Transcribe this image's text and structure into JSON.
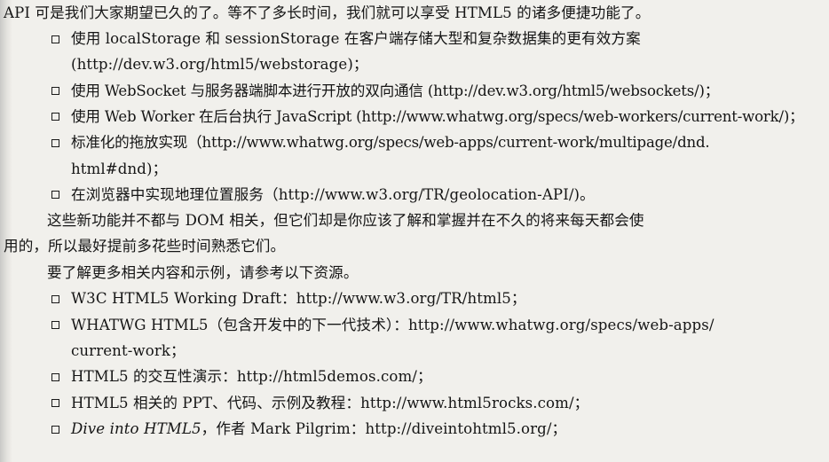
{
  "page": {
    "intro_line": "API 可是我们大家期望已久的了。等不了多长时间，我们就可以享受 HTML5 的诸多便捷功能了。",
    "feature_list": [
      {
        "line1": "使用 localStorage 和 sessionStorage 在客户端存储大型和复杂数据集的更有效方案",
        "line2": "(http://dev.w3.org/html5/webstorage)；"
      },
      {
        "line1": "使用 WebSocket 与服务器端脚本进行开放的双向通信 (http://dev.w3.org/html5/websockets/)；"
      },
      {
        "line1": "使用 Web Worker 在后台执行 JavaScript (http://www.whatwg.org/specs/web-workers/current-work/)；"
      },
      {
        "line1": "标准化的拖放实现（http://www.whatwg.org/specs/web-apps/current-work/multipage/dnd.",
        "line2": "html#dnd)；"
      },
      {
        "line1": "在浏览器中实现地理位置服务（http://www.w3.org/TR/geolocation-API/)。"
      }
    ],
    "para2_line1": "这些新功能并不都与 DOM 相关，但它们却是你应该了解和掌握并在不久的将来每天都会使",
    "para2_line2": "用的，所以最好提前多花些时间熟悉它们。",
    "para3": "要了解更多相关内容和示例，请参考以下资源。",
    "resource_list": [
      {
        "line1": "W3C HTML5 Working Draft：http://www.w3.org/TR/html5；"
      },
      {
        "line1": "WHATWG HTML5（包含开发中的下一代技术）：http://www.whatwg.org/specs/web-apps/",
        "line2": "current-work；"
      },
      {
        "line1": "HTML5 的交互性演示：http://html5demos.com/；"
      },
      {
        "line1": "HTML5 相关的 PPT、代码、示例及教程：http://www.html5rocks.com/；"
      },
      {
        "title_italic": "Dive into HTML5",
        "line1_rest": "，作者 Mark Pilgrim：http://diveintohtml5.org/；"
      }
    ]
  }
}
